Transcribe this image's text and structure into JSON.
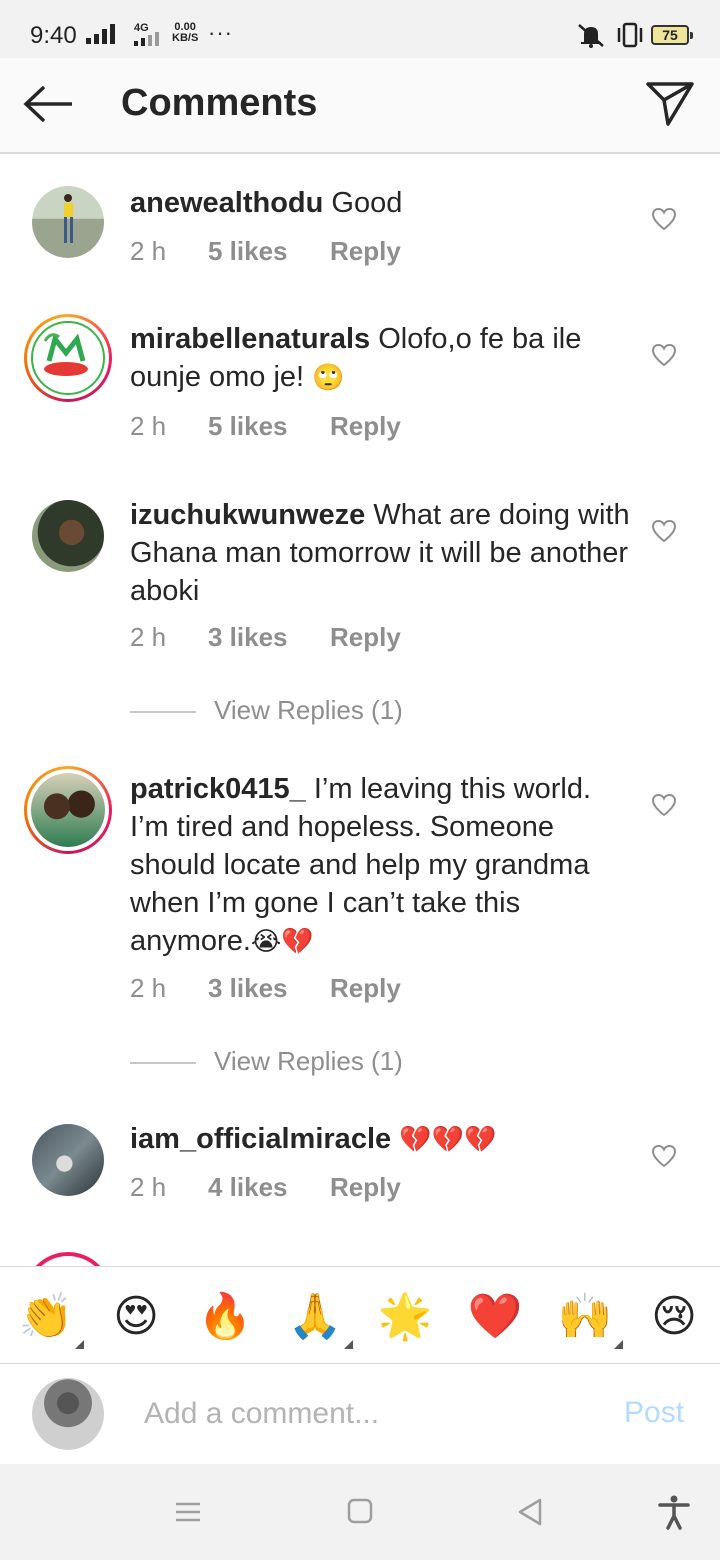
{
  "status_bar": {
    "time": "9:40",
    "network": "4G",
    "speed_value": "0.00",
    "speed_unit": "KB/S",
    "more": "···",
    "battery": "75"
  },
  "header": {
    "title": "Comments",
    "back_icon": "arrow-left-icon",
    "send_icon": "paper-plane-icon"
  },
  "comments": [
    {
      "username": "anewealthodu",
      "text": "Good",
      "emoji": "",
      "time": "2 h",
      "likes": "5 likes",
      "reply": "Reply"
    },
    {
      "username": "mirabellenaturals",
      "text": "Olofo,o fe ba ile ounje omo je!",
      "emoji": "🙄",
      "time": "2 h",
      "likes": "5 likes",
      "reply": "Reply"
    },
    {
      "username": "izuchukwunweze",
      "text": "What are doing with Ghana man tomorrow it will be  another aboki",
      "emoji": "",
      "time": "2 h",
      "likes": "3 likes",
      "reply": "Reply",
      "view_replies": "View Replies (1)"
    },
    {
      "username": "patrick0415_",
      "text": "I’m leaving this world. I’m tired and hopeless. Someone should locate and help my grandma when I’m gone I can’t take this anymore.",
      "emoji": "😭💔",
      "time": "2 h",
      "likes": "3 likes",
      "reply": "Reply",
      "view_replies": "View Replies (1)"
    },
    {
      "username": "iam_officialmiracle",
      "text": "",
      "emoji": "💔💔💔",
      "time": "2 h",
      "likes": "4 likes",
      "reply": "Reply"
    }
  ],
  "emoji_bar": [
    "👏",
    "😍",
    "🔥",
    "🙏",
    "🌟",
    "❤️",
    "🙌",
    "😢"
  ],
  "composer": {
    "placeholder": "Add a comment...",
    "post": "Post"
  },
  "colors": {
    "text": "#262626",
    "meta": "#8e8e8e",
    "post_disabled": "#b3dbff",
    "story_ring_start": "#f9a825",
    "story_ring_end": "#e91e63"
  }
}
